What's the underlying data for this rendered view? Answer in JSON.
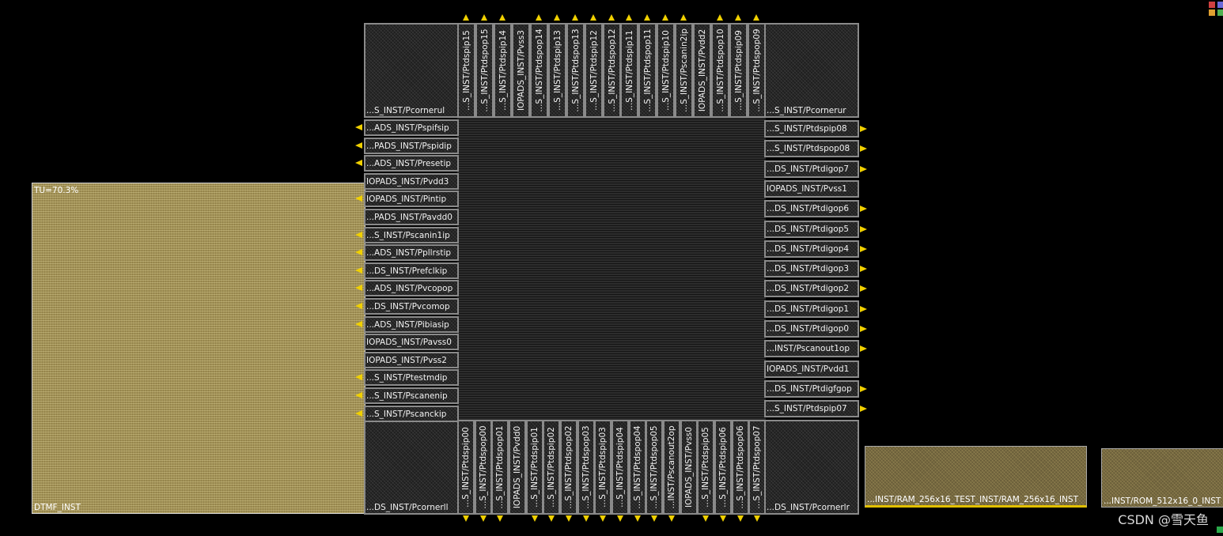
{
  "layout_view": {
    "core_label": "",
    "colors": {
      "pad_border": "#8a8a8a",
      "pin": "#f0d000",
      "macro_fill": "#a09055",
      "background": "#000000"
    }
  },
  "corners": [
    {
      "id": "ul",
      "label": "...S_INST/Pcornerul"
    },
    {
      "id": "ur",
      "label": "...S_INST/Pcornerur"
    },
    {
      "id": "ll",
      "label": "...DS_INST/Pcornerll"
    },
    {
      "id": "lr",
      "label": "...DS_INST/Pcornerlr"
    }
  ],
  "top_pads": [
    "...S_INST/Ptdspip15",
    "...S_INST/Ptdspop15",
    "...S_INST/Ptdspip14",
    "IOPADS_INST/Pvss3",
    "...S_INST/Ptdspop14",
    "...S_INST/Ptdspip13",
    "...S_INST/Ptdspop13",
    "...S_INST/Ptdspip12",
    "...S_INST/Ptdspop12",
    "...S_INST/Ptdspip11",
    "...S_INST/Ptdspop11",
    "...S_INST/Ptdspip10",
    "...S_INST/Pscanin2ip",
    "IOPADS_INST/Pvdd2",
    "...S_INST/Ptdspop10",
    "...S_INST/Ptdspip09",
    "...S_INST/Ptdspop09"
  ],
  "bottom_pads": [
    "...S_INST/Ptdspip00",
    "...S_INST/Ptdspop00",
    "...S_INST/Ptdspop01",
    "IOPADS_INST/Pvdd0",
    "...S_INST/Ptdspip01",
    "...S_INST/Ptdspip02",
    "...S_INST/Ptdspop02",
    "...S_INST/Ptdspop03",
    "...S_INST/Ptdspip03",
    "...S_INST/Ptdspip04",
    "...S_INST/Ptdspop04",
    "...S_INST/Ptdspop05",
    "...INST/Pscanout2op",
    "IOPADS_INST/Pvss0",
    "...S_INST/Ptdspip05",
    "...S_INST/Ptdspip06",
    "...S_INST/Ptdspop06",
    "...S_INST/Ptdspop07"
  ],
  "left_pads": [
    "...ADS_INST/Pspifsip",
    "...PADS_INST/Pspidip",
    "...ADS_INST/Presetip",
    "IOPADS_INST/Pvdd3",
    "IOPADS_INST/Pintip",
    "...PADS_INST/Pavdd0",
    "...S_INST/Pscanin1ip",
    "...ADS_INST/Ppllrstip",
    "...DS_INST/Prefclkip",
    "...ADS_INST/Pvcopop",
    "...DS_INST/Pvcomop",
    "...ADS_INST/Pibiasip",
    "IOPADS_INST/Pavss0",
    "IOPADS_INST/Pvss2",
    "...S_INST/Ptestmdip",
    "...S_INST/Pscanenip",
    "...S_INST/Pscanckip"
  ],
  "right_pads": [
    "...S_INST/Ptdspip08",
    "...S_INST/Ptdspop08",
    "...DS_INST/Ptdigop7",
    "IOPADS_INST/Pvss1",
    "...DS_INST/Ptdigop6",
    "...DS_INST/Ptdigop5",
    "...DS_INST/Ptdigop4",
    "...DS_INST/Ptdigop3",
    "...DS_INST/Ptdigop2",
    "...DS_INST/Ptdigop1",
    "...DS_INST/Ptdigop0",
    "...INST/Pscanout1op",
    "IOPADS_INST/Pvdd1",
    "...DS_INST/Ptdigfgop",
    "...S_INST/Ptdspip07"
  ],
  "macros": {
    "dtmf": {
      "name": "DTMF_INST",
      "info": "TU=70.3%"
    },
    "ram": {
      "name": "...INST/RAM_256x16_TEST_INST/RAM_256x16_INST"
    },
    "rom": {
      "name": "...INST/ROM_512x16_0_INST"
    }
  },
  "watermark": "CSDN @雪天鱼"
}
